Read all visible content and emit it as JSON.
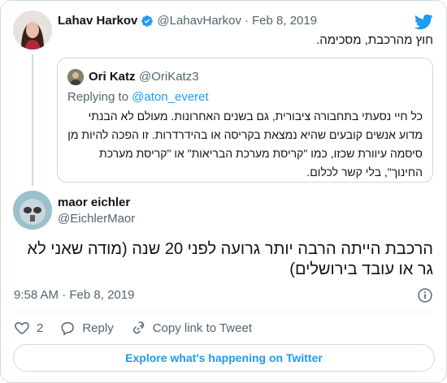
{
  "tweet_parent": {
    "author_name": "Lahav Harkov",
    "author_handle": "@LahavHarkov",
    "separator": "·",
    "date": "Feb 8, 2019",
    "text": "חוץ מהרכבת, מסכימה."
  },
  "quoted_tweet": {
    "author_name": "Ori Katz",
    "author_handle": "@OriKatz3",
    "replying_prefix": "Replying to",
    "replying_to": "@aton_everet",
    "text": "כל חיי נסעתי בתחבורה ציבורית, גם בשנים האחרונות. מעולם לא הבנתי מדוע אנשים קובעים שהיא נמצאת בקריסה או בהידרדרות. זו הפכה להיות מן סיסמה עיוורת שכזו, כמו \"קריסת מערכת הבריאות\" או \"קריסת מערכת החינוך\", בלי קשר לכלום."
  },
  "tweet_main": {
    "author_name": "maor eichler",
    "author_handle": "@EichlerMaor",
    "text": "הרכבת הייתה הרבה יותר גרועה לפני 20 שנה (מודה שאני לא גר או עובד בירושלים)",
    "time": "9:58 AM",
    "separator": "·",
    "date": "Feb 8, 2019"
  },
  "actions": {
    "like_count": "2",
    "reply_label": "Reply",
    "copy_link_label": "Copy link to Tweet"
  },
  "explore_label": "Explore what's happening on Twitter",
  "colors": {
    "accent": "#1d9bf0",
    "text": "#0f1419",
    "muted": "#536471",
    "border": "#cfd9de"
  },
  "icons": {
    "brand": "twitter-bird-icon",
    "verified": "verified-badge-icon",
    "info": "info-icon",
    "like": "heart-icon",
    "reply": "reply-bubble-icon",
    "link": "link-icon"
  }
}
